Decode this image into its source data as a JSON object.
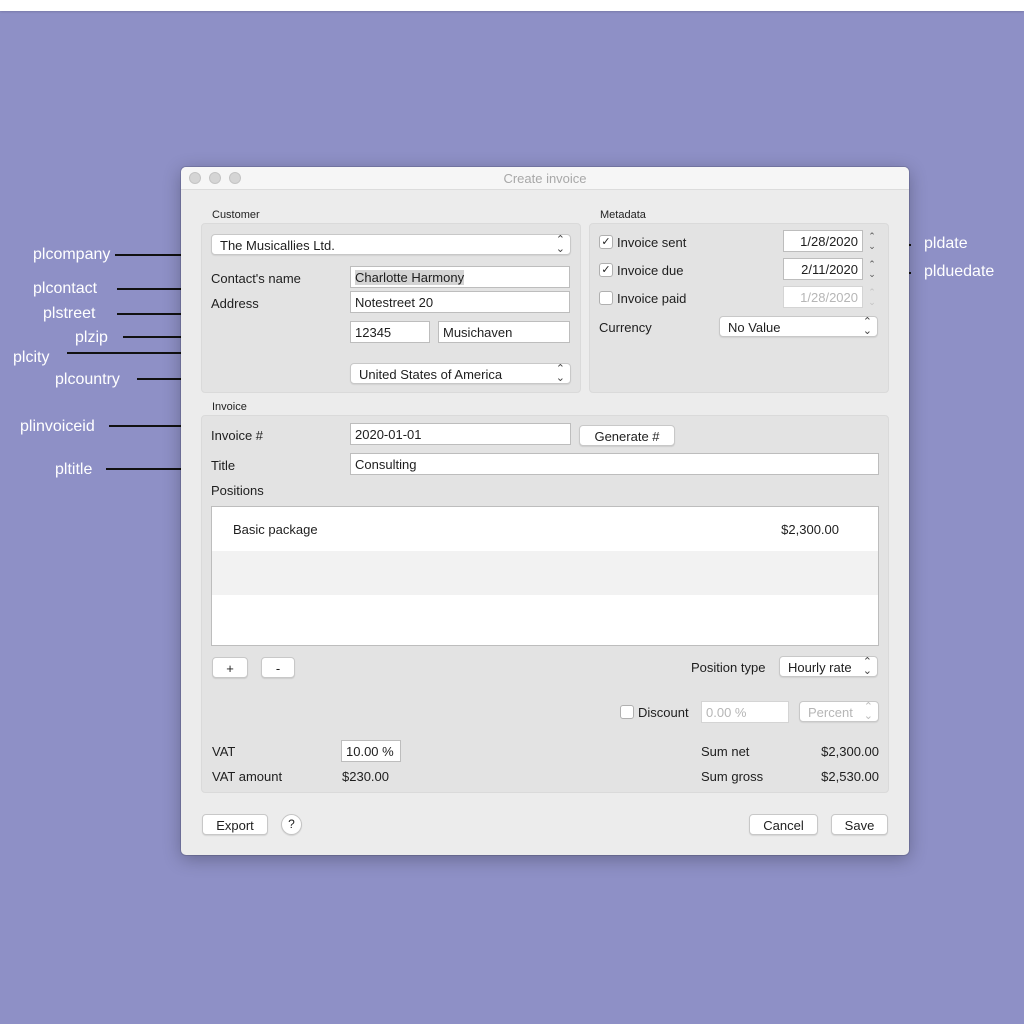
{
  "annotations": {
    "company": "plcompany",
    "contact": "plcontact",
    "street": "plstreet",
    "zip": "plzip",
    "city": "plcity",
    "country": "plcountry",
    "invoiceid": "plinvoiceid",
    "title": "pltitle",
    "date": "pldate",
    "duedate": "plduedate"
  },
  "window": {
    "title": "Create invoice"
  },
  "customer": {
    "group_title": "Customer",
    "company": "The Musicallies Ltd.",
    "contact_label": "Contact's name",
    "contact": "Charlotte Harmony",
    "address_label": "Address",
    "street": "Notestreet 20",
    "zip": "12345",
    "city": "Musichaven",
    "country": "United States of America"
  },
  "metadata": {
    "group_title": "Metadata",
    "invoice_sent": {
      "label": "Invoice sent",
      "checked": true,
      "date": "1/28/2020"
    },
    "invoice_due": {
      "label": "Invoice due",
      "checked": true,
      "date": "2/11/2020"
    },
    "invoice_paid": {
      "label": "Invoice paid",
      "checked": false,
      "date": "1/28/2020"
    },
    "currency_label": "Currency",
    "currency_value": "No Value"
  },
  "invoice": {
    "group_title": "Invoice",
    "number_label": "Invoice #",
    "number": "2020-01-01",
    "generate_label": "Generate #",
    "title_label": "Title",
    "title": "Consulting",
    "positions_label": "Positions",
    "positions": [
      {
        "name": "Basic package",
        "price": "$2,300.00"
      }
    ],
    "add_label": "+",
    "remove_label": "-",
    "position_type_label": "Position type",
    "position_type_value": "Hourly rate",
    "discount_label": "Discount",
    "discount_checked": false,
    "discount_placeholder": "0.00 %",
    "discount_unit": "Percent",
    "vat_label": "VAT",
    "vat_value": "10.00 %",
    "vat_amount_label": "VAT amount",
    "vat_amount": "$230.00",
    "sum_net_label": "Sum net",
    "sum_net": "$2,300.00",
    "sum_gross_label": "Sum gross",
    "sum_gross": "$2,530.00"
  },
  "footer": {
    "export_label": "Export",
    "help_label": "?",
    "cancel_label": "Cancel",
    "save_label": "Save"
  },
  "icons": {
    "checkmark": "✓",
    "chevron": "⌃⌄"
  }
}
